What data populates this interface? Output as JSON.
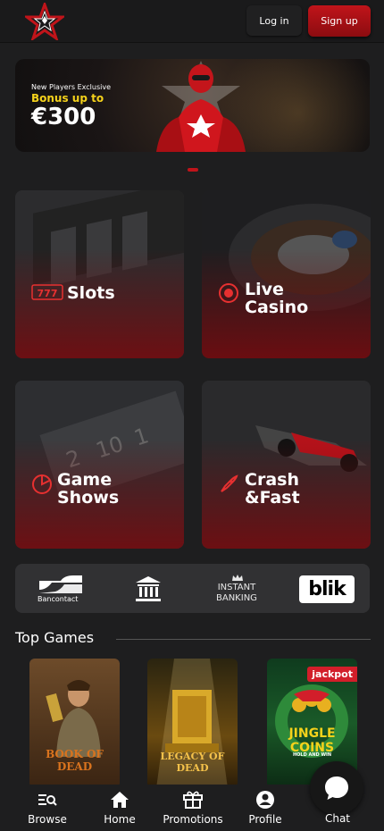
{
  "header": {
    "login_label": "Log in",
    "signup_label": "Sign up"
  },
  "hero": {
    "kicker": "New Players Exclusive",
    "bonus": "Bonus up to",
    "amount": "€300"
  },
  "categories": [
    {
      "label": "Slots"
    },
    {
      "label": "Live\nCasino"
    },
    {
      "label": "Game\nShows"
    },
    {
      "label": "Crash\n&Fast"
    }
  ],
  "payments": {
    "bancontact": "Bancontact",
    "instant": "INSTANT\nBANKING",
    "blik": "blik"
  },
  "top_games": {
    "title": "Top Games",
    "games": [
      {
        "title": "BOOK OF DEAD"
      },
      {
        "title": "LEGACY OF DEAD"
      },
      {
        "title": "JINGLE COINS",
        "badge": "jackpot",
        "sub": "HOLD AND WIN"
      }
    ]
  },
  "nav": [
    {
      "label": "Browse",
      "icon": "browse-icon"
    },
    {
      "label": "Home",
      "icon": "home-icon"
    },
    {
      "label": "Promotions",
      "icon": "gift-icon"
    },
    {
      "label": "Profile",
      "icon": "profile-icon"
    }
  ],
  "chat": {
    "label": "Chat"
  },
  "colors": {
    "brand_red": "#c0141a",
    "bonus_yellow": "#f5d21b",
    "background": "#1e1e1f"
  }
}
